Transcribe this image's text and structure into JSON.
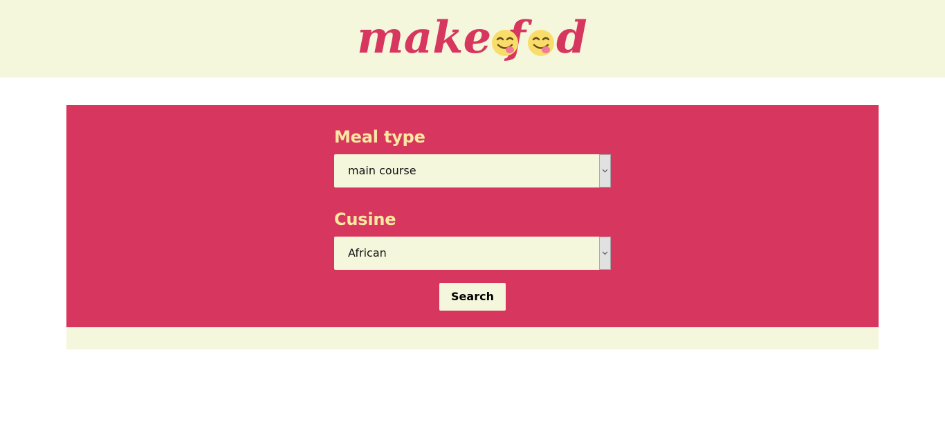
{
  "header": {
    "logo_text_part1": "make f",
    "logo_text_part2": "d",
    "logo_emoji_1": "yum-face-icon",
    "logo_emoji_2": "yum-face-icon"
  },
  "form": {
    "meal_type": {
      "label": "Meal type",
      "selected": "main course"
    },
    "cuisine": {
      "label": "Cusine",
      "selected": "African"
    },
    "search_label": "Search"
  },
  "colors": {
    "brand": "#d7375e",
    "cream": "#f5f7dc",
    "label": "#fbe9a1",
    "emoji": "#f9dd6a"
  }
}
